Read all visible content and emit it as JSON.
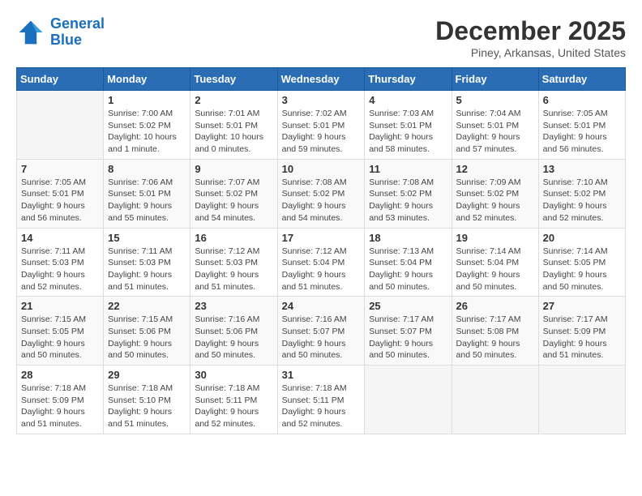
{
  "header": {
    "logo_line1": "General",
    "logo_line2": "Blue",
    "month": "December 2025",
    "location": "Piney, Arkansas, United States"
  },
  "weekdays": [
    "Sunday",
    "Monday",
    "Tuesday",
    "Wednesday",
    "Thursday",
    "Friday",
    "Saturday"
  ],
  "weeks": [
    [
      {
        "day": "",
        "info": ""
      },
      {
        "day": "1",
        "info": "Sunrise: 7:00 AM\nSunset: 5:02 PM\nDaylight: 10 hours\nand 1 minute."
      },
      {
        "day": "2",
        "info": "Sunrise: 7:01 AM\nSunset: 5:01 PM\nDaylight: 10 hours\nand 0 minutes."
      },
      {
        "day": "3",
        "info": "Sunrise: 7:02 AM\nSunset: 5:01 PM\nDaylight: 9 hours\nand 59 minutes."
      },
      {
        "day": "4",
        "info": "Sunrise: 7:03 AM\nSunset: 5:01 PM\nDaylight: 9 hours\nand 58 minutes."
      },
      {
        "day": "5",
        "info": "Sunrise: 7:04 AM\nSunset: 5:01 PM\nDaylight: 9 hours\nand 57 minutes."
      },
      {
        "day": "6",
        "info": "Sunrise: 7:05 AM\nSunset: 5:01 PM\nDaylight: 9 hours\nand 56 minutes."
      }
    ],
    [
      {
        "day": "7",
        "info": "Sunrise: 7:05 AM\nSunset: 5:01 PM\nDaylight: 9 hours\nand 56 minutes."
      },
      {
        "day": "8",
        "info": "Sunrise: 7:06 AM\nSunset: 5:01 PM\nDaylight: 9 hours\nand 55 minutes."
      },
      {
        "day": "9",
        "info": "Sunrise: 7:07 AM\nSunset: 5:02 PM\nDaylight: 9 hours\nand 54 minutes."
      },
      {
        "day": "10",
        "info": "Sunrise: 7:08 AM\nSunset: 5:02 PM\nDaylight: 9 hours\nand 54 minutes."
      },
      {
        "day": "11",
        "info": "Sunrise: 7:08 AM\nSunset: 5:02 PM\nDaylight: 9 hours\nand 53 minutes."
      },
      {
        "day": "12",
        "info": "Sunrise: 7:09 AM\nSunset: 5:02 PM\nDaylight: 9 hours\nand 52 minutes."
      },
      {
        "day": "13",
        "info": "Sunrise: 7:10 AM\nSunset: 5:02 PM\nDaylight: 9 hours\nand 52 minutes."
      }
    ],
    [
      {
        "day": "14",
        "info": "Sunrise: 7:11 AM\nSunset: 5:03 PM\nDaylight: 9 hours\nand 52 minutes."
      },
      {
        "day": "15",
        "info": "Sunrise: 7:11 AM\nSunset: 5:03 PM\nDaylight: 9 hours\nand 51 minutes."
      },
      {
        "day": "16",
        "info": "Sunrise: 7:12 AM\nSunset: 5:03 PM\nDaylight: 9 hours\nand 51 minutes."
      },
      {
        "day": "17",
        "info": "Sunrise: 7:12 AM\nSunset: 5:04 PM\nDaylight: 9 hours\nand 51 minutes."
      },
      {
        "day": "18",
        "info": "Sunrise: 7:13 AM\nSunset: 5:04 PM\nDaylight: 9 hours\nand 50 minutes."
      },
      {
        "day": "19",
        "info": "Sunrise: 7:14 AM\nSunset: 5:04 PM\nDaylight: 9 hours\nand 50 minutes."
      },
      {
        "day": "20",
        "info": "Sunrise: 7:14 AM\nSunset: 5:05 PM\nDaylight: 9 hours\nand 50 minutes."
      }
    ],
    [
      {
        "day": "21",
        "info": "Sunrise: 7:15 AM\nSunset: 5:05 PM\nDaylight: 9 hours\nand 50 minutes."
      },
      {
        "day": "22",
        "info": "Sunrise: 7:15 AM\nSunset: 5:06 PM\nDaylight: 9 hours\nand 50 minutes."
      },
      {
        "day": "23",
        "info": "Sunrise: 7:16 AM\nSunset: 5:06 PM\nDaylight: 9 hours\nand 50 minutes."
      },
      {
        "day": "24",
        "info": "Sunrise: 7:16 AM\nSunset: 5:07 PM\nDaylight: 9 hours\nand 50 minutes."
      },
      {
        "day": "25",
        "info": "Sunrise: 7:17 AM\nSunset: 5:07 PM\nDaylight: 9 hours\nand 50 minutes."
      },
      {
        "day": "26",
        "info": "Sunrise: 7:17 AM\nSunset: 5:08 PM\nDaylight: 9 hours\nand 50 minutes."
      },
      {
        "day": "27",
        "info": "Sunrise: 7:17 AM\nSunset: 5:09 PM\nDaylight: 9 hours\nand 51 minutes."
      }
    ],
    [
      {
        "day": "28",
        "info": "Sunrise: 7:18 AM\nSunset: 5:09 PM\nDaylight: 9 hours\nand 51 minutes."
      },
      {
        "day": "29",
        "info": "Sunrise: 7:18 AM\nSunset: 5:10 PM\nDaylight: 9 hours\nand 51 minutes."
      },
      {
        "day": "30",
        "info": "Sunrise: 7:18 AM\nSunset: 5:11 PM\nDaylight: 9 hours\nand 52 minutes."
      },
      {
        "day": "31",
        "info": "Sunrise: 7:18 AM\nSunset: 5:11 PM\nDaylight: 9 hours\nand 52 minutes."
      },
      {
        "day": "",
        "info": ""
      },
      {
        "day": "",
        "info": ""
      },
      {
        "day": "",
        "info": ""
      }
    ]
  ]
}
